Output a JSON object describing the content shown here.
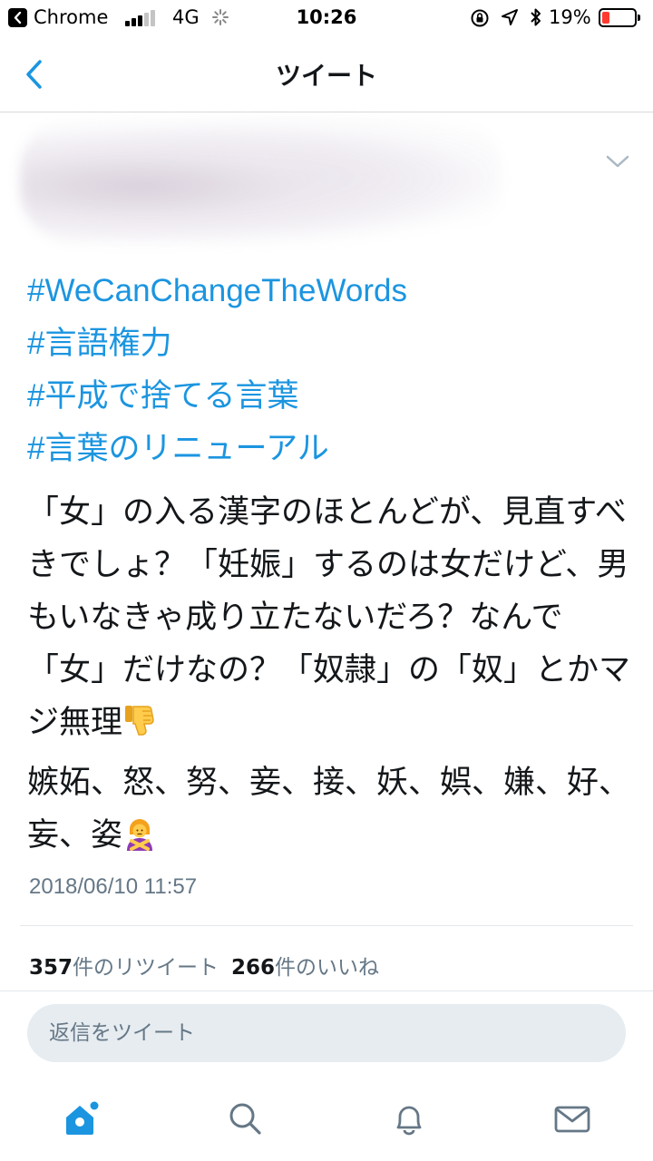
{
  "status_bar": {
    "back_app": "Chrome",
    "network": "4G",
    "time": "10:26",
    "battery_pct": "19%",
    "battery_color": "#ff3b30"
  },
  "nav": {
    "title": "ツイート",
    "back_icon": "chevron-left-icon"
  },
  "tweet": {
    "hashtags": [
      "#WeCanChangeTheWords",
      "#言語権力",
      "#平成で捨てる言葉",
      "#言葉のリニューアル"
    ],
    "body_line1": "「女」の入る漢字のほとんどが、見直すべきでしょ？「妊娠」するのは女だけど、男もいなきゃ成り立たないだろ？なんで「女」だけなの？「奴隷」の「奴」とかマジ無理",
    "body_line1_emoji": "thumbs-down-icon",
    "body_line2": "嫉妬、怒、努、妾、接、妖、娯、嫌、好、妄、姿",
    "body_line2_emoji": "person-gesturing-no-icon",
    "timestamp": "2018/06/10 11:57",
    "retweet_count": "357",
    "retweet_label": "件のリツイート",
    "like_count": "266",
    "like_label": "件のいいね",
    "link_color": "#1b95e0"
  },
  "reply": {
    "placeholder": "返信をツイート"
  },
  "tabs": [
    {
      "icon": "home-icon",
      "active": true
    },
    {
      "icon": "search-icon",
      "active": false
    },
    {
      "icon": "bell-icon",
      "active": false
    },
    {
      "icon": "mail-icon",
      "active": false
    }
  ]
}
